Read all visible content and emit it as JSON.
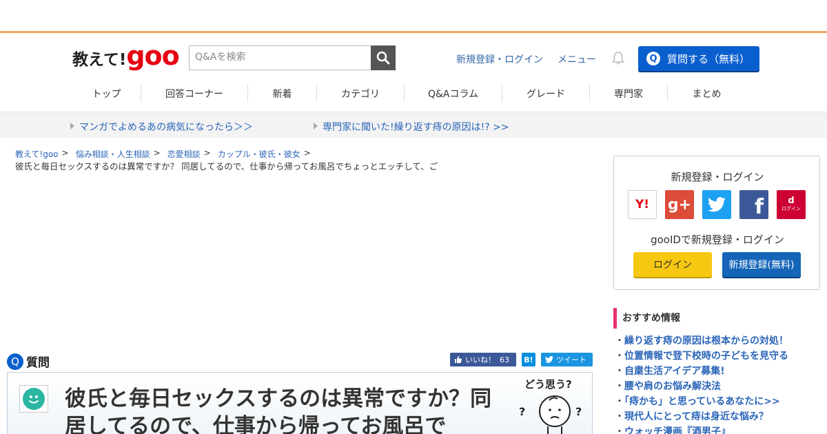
{
  "header": {
    "logo_text": "教えて!",
    "logo_goo": "goo",
    "search_placeholder": "Q&Aを検索",
    "links": [
      "新規登録・ログイン",
      "メニュー"
    ],
    "ask_button": "質問する（無料）"
  },
  "gnav": [
    "トップ",
    "回答コーナー",
    "新着",
    "カテゴリ",
    "Q&Aコラム",
    "グレード",
    "専門家",
    "まとめ"
  ],
  "subbar": [
    "マンガでよめるあの病気になったら＞＞",
    "専門家に聞いた!繰り返す痔の原因は!? >>"
  ],
  "breadcrumb": [
    "教えて!goo",
    "悩み相談・人生相談",
    "恋愛相談",
    "カップル・彼氏・彼女"
  ],
  "breadcrumb_sep": ">",
  "question_summary": "彼氏と毎日セックスするのは異常ですか？ 同居してるので、仕事から帰ってお風呂でちょっとエッチして、ご",
  "question": {
    "label": "質問",
    "badge": "Q",
    "title": "彼氏と毎日セックスするのは異常ですか？同居してるので、仕事から帰ってお風呂で",
    "illustration_text": "どう思う?"
  },
  "share": {
    "like_label": "いいね！",
    "like_count": "63",
    "hatena": "B!",
    "tweet": "ツイート"
  },
  "login_box": {
    "title": "新規登録・ログイン",
    "sns": [
      {
        "name": "yahoo",
        "label": "Y!",
        "color": "#ffffff"
      },
      {
        "name": "google-plus",
        "label": "g+",
        "color": "#dd4b39"
      },
      {
        "name": "twitter",
        "label": "",
        "color": "#1da1f2"
      },
      {
        "name": "facebook",
        "label": "f",
        "color": "#3b5998"
      },
      {
        "name": "docomo",
        "label": "ログイン",
        "color": "#cc0033"
      }
    ],
    "gooid_text": "gooIDで新規登録・ログイン",
    "login_button": "ログイン",
    "register_button": "新規登録(無料)"
  },
  "recommend": {
    "title": "おすすめ情報",
    "items": [
      "繰り返す痔の原因は根本からの対処！",
      "位置情報で登下校時の子どもを見守る",
      "自粛生活アイデア募集!",
      "腰や肩のお悩み解決法",
      "「痔かも」と思っているあなたに>>",
      "現代人にとって痔は身近な悩み？",
      "ウォッチ漫画『酒男子』"
    ]
  },
  "colors": {
    "accent_orange": "#f6a35e",
    "brand_red": "#e60012",
    "primary_blue": "#0a5fcf",
    "link_blue": "#2a65b8",
    "recommend_pink": "#e8336b"
  }
}
